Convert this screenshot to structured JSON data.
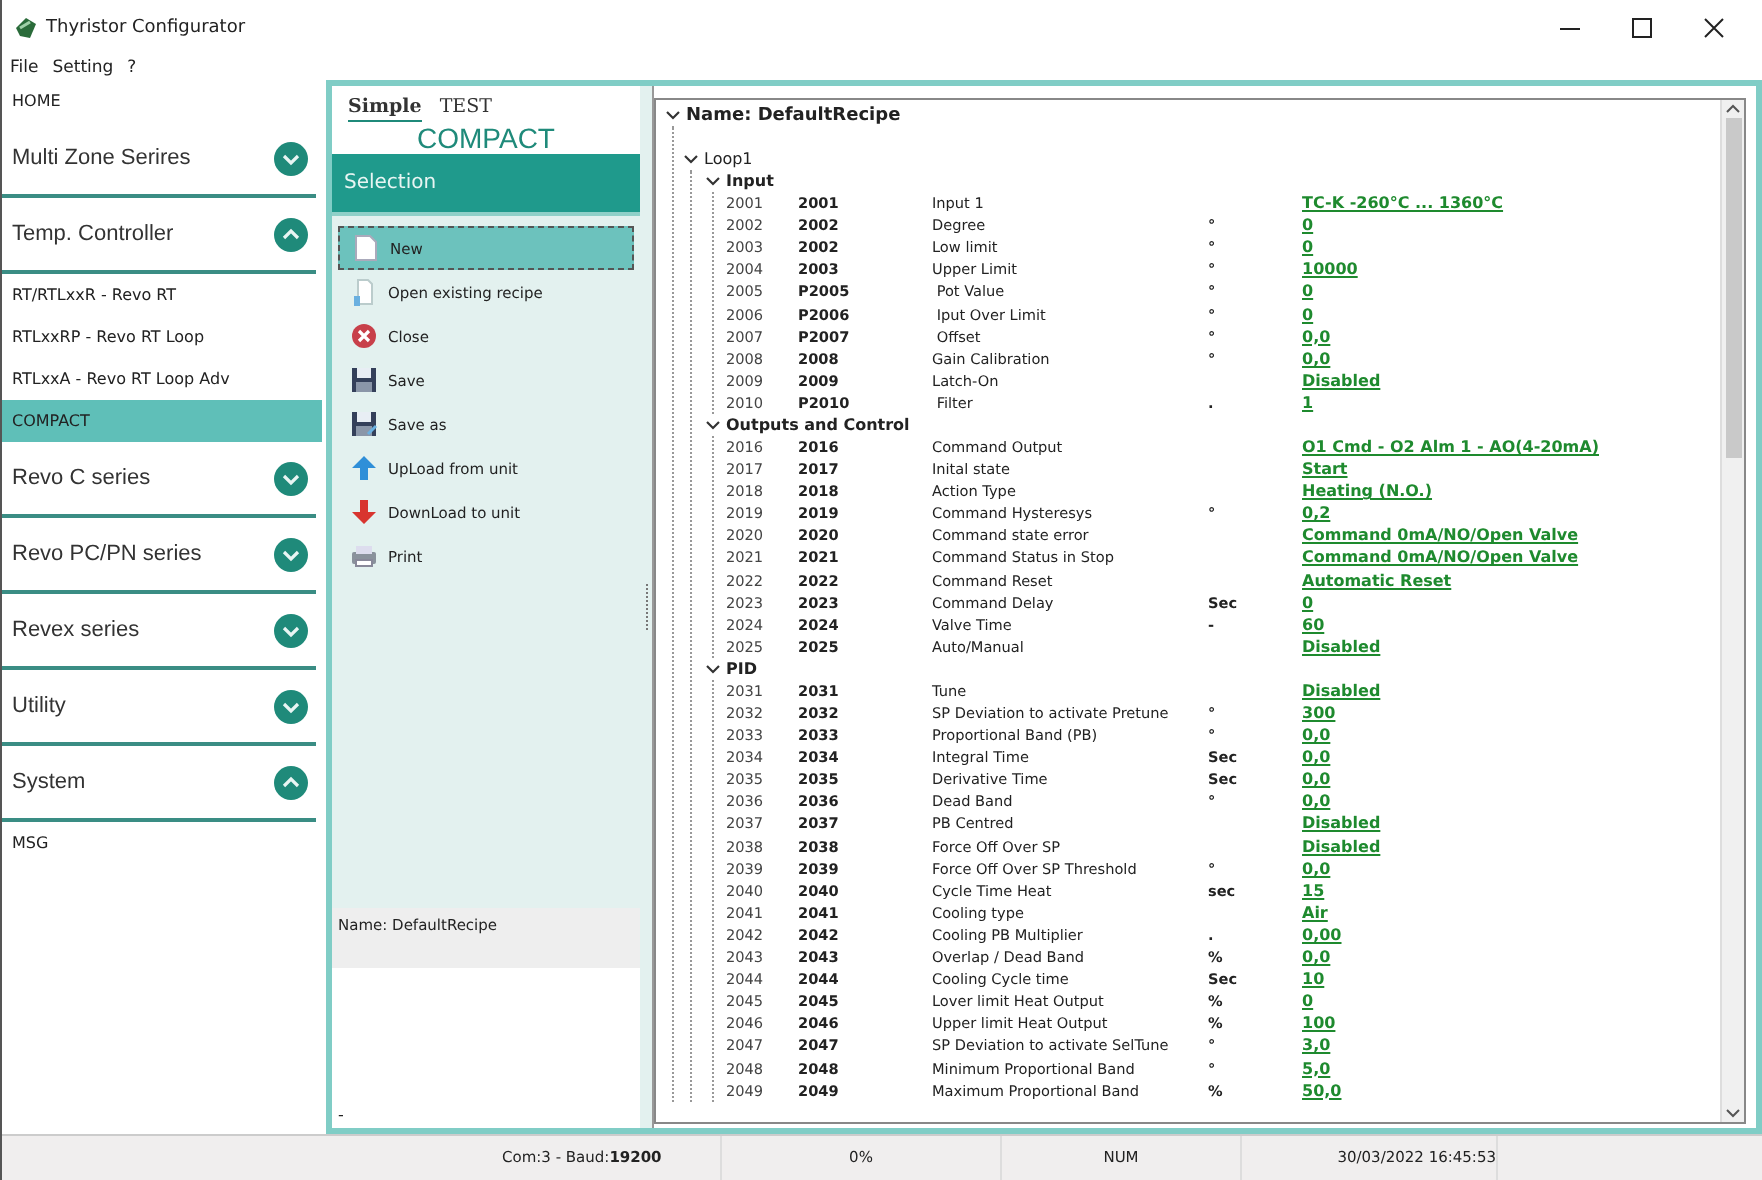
{
  "window": {
    "title": "Thyristor Configurator"
  },
  "menu": [
    "File",
    "Setting",
    "?"
  ],
  "sidebar": {
    "items": [
      {
        "kind": "item",
        "label": "HOME",
        "selected": false
      },
      {
        "kind": "section",
        "label": "Multi Zone Serires",
        "expanded": false
      },
      {
        "kind": "section",
        "label": "Temp. Controller",
        "expanded": true
      },
      {
        "kind": "item",
        "label": "RT/RTLxxR  - Revo RT",
        "selected": false
      },
      {
        "kind": "item",
        "label": "RTLxxRP  - Revo RT Loop",
        "selected": false
      },
      {
        "kind": "item",
        "label": "RTLxxA  - Revo RT Loop Adv",
        "selected": false
      },
      {
        "kind": "item",
        "label": "COMPACT",
        "selected": true
      },
      {
        "kind": "section",
        "label": "Revo C series",
        "expanded": false
      },
      {
        "kind": "section",
        "label": "Revo PC/PN series",
        "expanded": false
      },
      {
        "kind": "section",
        "label": "Revex series",
        "expanded": false
      },
      {
        "kind": "section",
        "label": "Utility",
        "expanded": false
      },
      {
        "kind": "section",
        "label": "System",
        "expanded": true
      },
      {
        "kind": "item",
        "label": "MSG",
        "selected": false
      }
    ]
  },
  "tabs": [
    {
      "label": "Simple",
      "selected": true
    },
    {
      "label": "TEST",
      "selected": false
    }
  ],
  "panel_title": "COMPACT",
  "selection": {
    "header": "Selection",
    "items": [
      {
        "kind": "new",
        "label": "New",
        "selected": true
      },
      {
        "kind": "open",
        "label": "Open existing recipe",
        "selected": false
      },
      {
        "kind": "close",
        "label": "Close",
        "selected": false
      },
      {
        "kind": "save",
        "label": "Save",
        "selected": false
      },
      {
        "kind": "saveas",
        "label": "Save as",
        "selected": false
      },
      {
        "kind": "upload",
        "label": "UpLoad from unit",
        "selected": false
      },
      {
        "kind": "download",
        "label": "DownLoad to unit",
        "selected": false
      },
      {
        "kind": "print",
        "label": "Print",
        "selected": false
      }
    ],
    "name_bar": "Name: DefaultRecipe",
    "footer": "-"
  },
  "tree": {
    "label": "Name: DefaultRecipe",
    "expanded": true,
    "children": [
      {
        "label": "Loop1",
        "expanded": true,
        "children": [
          {
            "label": "Input",
            "expanded": true,
            "rows": [
              {
                "index": "2001",
                "code": "2001",
                "name": "Input 1",
                "unit": "",
                "value": "TC-K -260°C ... 1360°C"
              },
              {
                "index": "2002",
                "code": "2002",
                "name": "Degree",
                "unit": "°",
                "value": "0"
              },
              {
                "index": "2003",
                "code": "2002",
                "name": "Low limit",
                "unit": "°",
                "value": "0"
              },
              {
                "index": "2004",
                "code": "2003",
                "name": "Upper Limit",
                "unit": "°",
                "value": "10000"
              },
              {
                "index": "2005",
                "code": "P2005",
                "name": " Pot Value",
                "unit": "°",
                "value": "0"
              },
              {
                "index": "2006",
                "code": "P2006",
                "name": " Iput Over Limit",
                "unit": "°",
                "value": "0"
              },
              {
                "index": "2007",
                "code": "P2007",
                "name": " Offset",
                "unit": "°",
                "value": "0,0"
              },
              {
                "index": "2008",
                "code": "2008",
                "name": "Gain Calibration",
                "unit": "°",
                "value": "0,0"
              },
              {
                "index": "2009",
                "code": "2009",
                "name": "Latch-On",
                "unit": "",
                "value": "Disabled"
              },
              {
                "index": "2010",
                "code": "P2010",
                "name": " Filter",
                "unit": ".",
                "value": "1"
              }
            ]
          },
          {
            "label": "Outputs and Control",
            "expanded": true,
            "rows": [
              {
                "index": "2016",
                "code": "2016",
                "name": "Command Output",
                "unit": "",
                "value": "O1 Cmd - O2 Alm 1 - AO(4-20mA)"
              },
              {
                "index": "2017",
                "code": "2017",
                "name": "Inital state",
                "unit": "",
                "value": "Start"
              },
              {
                "index": "2018",
                "code": "2018",
                "name": "Action Type",
                "unit": "",
                "value": "Heating (N.O.)"
              },
              {
                "index": "2019",
                "code": "2019",
                "name": "Command Hysteresys",
                "unit": "°",
                "value": "0,2"
              },
              {
                "index": "2020",
                "code": "2020",
                "name": "Command state error",
                "unit": "",
                "value": "Command 0mA/NO/Open Valve"
              },
              {
                "index": "2021",
                "code": "2021",
                "name": "Command Status in Stop",
                "unit": "",
                "value": "Command 0mA/NO/Open Valve"
              },
              {
                "index": "2022",
                "code": "2022",
                "name": "Command Reset",
                "unit": "",
                "value": "Automatic Reset"
              },
              {
                "index": "2023",
                "code": "2023",
                "name": "Command Delay",
                "unit": "Sec",
                "value": "0"
              },
              {
                "index": "2024",
                "code": "2024",
                "name": "Valve Time",
                "unit": "-",
                "value": "60"
              },
              {
                "index": "2025",
                "code": "2025",
                "name": "Auto/Manual",
                "unit": "",
                "value": "Disabled"
              }
            ]
          },
          {
            "label": "PID",
            "expanded": true,
            "rows": [
              {
                "index": "2031",
                "code": "2031",
                "name": "Tune",
                "unit": "",
                "value": "Disabled"
              },
              {
                "index": "2032",
                "code": "2032",
                "name": "SP Deviation to activate Pretune",
                "unit": "°",
                "value": "300"
              },
              {
                "index": "2033",
                "code": "2033",
                "name": "Proportional Band (PB)",
                "unit": "°",
                "value": "0,0"
              },
              {
                "index": "2034",
                "code": "2034",
                "name": "Integral Time",
                "unit": "Sec",
                "value": "0,0"
              },
              {
                "index": "2035",
                "code": "2035",
                "name": "Derivative Time",
                "unit": "Sec",
                "value": "0,0"
              },
              {
                "index": "2036",
                "code": "2036",
                "name": "Dead Band",
                "unit": "°",
                "value": "0,0"
              },
              {
                "index": "2037",
                "code": "2037",
                "name": "PB Centred",
                "unit": "",
                "value": "Disabled"
              },
              {
                "index": "2038",
                "code": "2038",
                "name": "Force Off Over SP",
                "unit": "",
                "value": "Disabled"
              },
              {
                "index": "2039",
                "code": "2039",
                "name": "Force Off Over SP Threshold",
                "unit": "°",
                "value": "0,0"
              },
              {
                "index": "2040",
                "code": "2040",
                "name": "Cycle Time Heat",
                "unit": "sec",
                "value": "15"
              },
              {
                "index": "2041",
                "code": "2041",
                "name": "Cooling type",
                "unit": "",
                "value": "Air"
              },
              {
                "index": "2042",
                "code": "2042",
                "name": "Cooling PB Multiplier",
                "unit": ".",
                "value": "0,00"
              },
              {
                "index": "2043",
                "code": "2043",
                "name": "Overlap / Dead Band",
                "unit": "%",
                "value": "0,0"
              },
              {
                "index": "2044",
                "code": "2044",
                "name": "Cooling Cycle time",
                "unit": "Sec",
                "value": "10"
              },
              {
                "index": "2045",
                "code": "2045",
                "name": "Lover limit Heat Output",
                "unit": "%",
                "value": "0"
              },
              {
                "index": "2046",
                "code": "2046",
                "name": "Upper limit Heat Output",
                "unit": "%",
                "value": "100"
              },
              {
                "index": "2047",
                "code": "2047",
                "name": "SP Deviation to activate SelTune",
                "unit": "°",
                "value": "3,0"
              },
              {
                "index": "2048",
                "code": "2048",
                "name": "Minimum Proportional Band",
                "unit": "°",
                "value": "5,0"
              },
              {
                "index": "2049",
                "code": "2049",
                "name": "Maximum Proportional Band",
                "unit": "%",
                "value": "50,0"
              }
            ]
          }
        ]
      }
    ]
  },
  "status_bar": {
    "port": "Com:3 - Baud:**19200**",
    "progress": "0%",
    "keys": "NUM",
    "datetime": "30/03/2022 16:45:53"
  }
}
